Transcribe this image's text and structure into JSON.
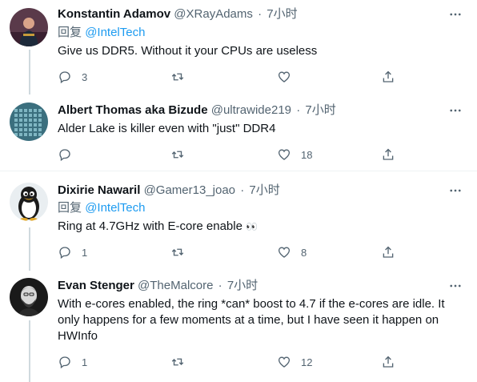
{
  "colors": {
    "link": "#1d9bf0",
    "secondary": "#536471",
    "divider": "#eff3f4",
    "thread": "#cfd9de"
  },
  "tweets": [
    {
      "name": "Konstantin Adamov",
      "handle": "@XRayAdams",
      "dot": "·",
      "time": "7小时",
      "reply_prefix": "回复",
      "reply_to": "@IntelTech",
      "text": "Give us DDR5. Without it your CPUs are useless",
      "replies": "3",
      "retweets": "",
      "likes": "",
      "icons": {
        "reply": "comment-icon",
        "retweet": "retweet-icon",
        "like": "heart-icon",
        "share": "share-icon",
        "more": "more-icon"
      }
    },
    {
      "name": "Albert Thomas aka Bizude",
      "handle": "@ultrawide219",
      "dot": "·",
      "time": "7小时",
      "text": "Alder Lake is killer even with \"just\" DDR4",
      "replies": "",
      "retweets": "",
      "likes": "18"
    },
    {
      "name": "Dixirie Nawaril",
      "handle": "@Gamer13_joao",
      "dot": "·",
      "time": "7小时",
      "reply_prefix": "回复",
      "reply_to": "@IntelTech",
      "text": "Ring at 4.7GHz with E-core enable ",
      "emoji": "👀",
      "replies": "1",
      "retweets": "",
      "likes": "8"
    },
    {
      "name": "Evan Stenger",
      "handle": "@TheMalcore",
      "dot": "·",
      "time": "7小时",
      "text_lines": [
        "With e-cores enabled, the ring *can* boost to 4.7 if the e-cores are idle. It",
        "only happens for a few moments at a time, but I have seen it happen on",
        "HWInfo"
      ],
      "replies": "1",
      "retweets": "",
      "likes": "12"
    }
  ]
}
